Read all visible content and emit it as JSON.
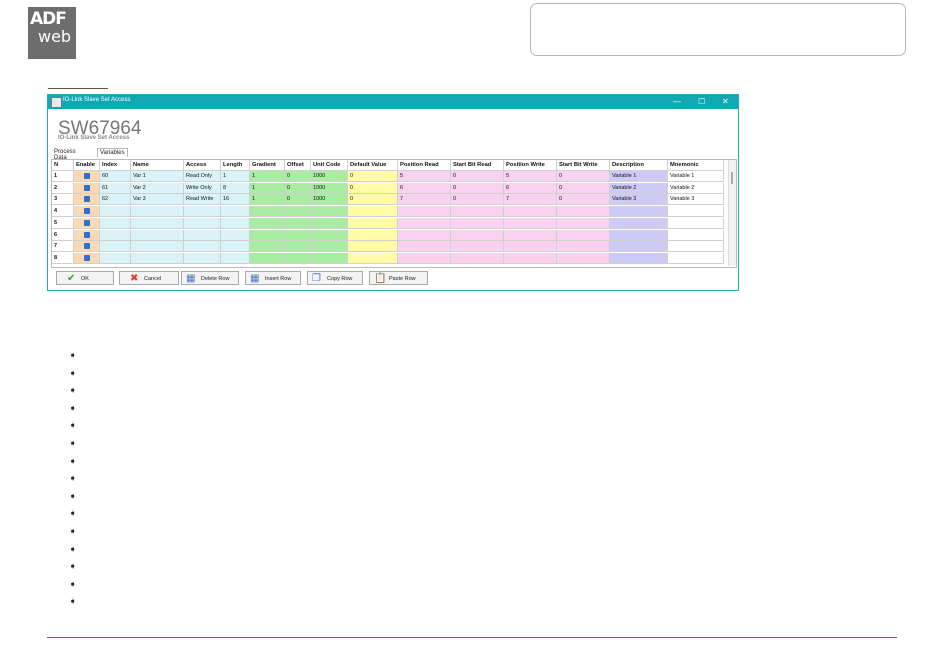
{
  "logo": {
    "line1": "ADF",
    "line2": "web"
  },
  "window": {
    "title": "IO-Link Slave Set Access",
    "controls": {
      "minimize": "—",
      "maximize": "☐",
      "close": "✕"
    },
    "big_title": "SW67964",
    "subtitle": "IO-Link Slave Set Access",
    "tabs": [
      "Process Data",
      "Variables"
    ],
    "active_tab": "Variables"
  },
  "table": {
    "columns": [
      "N",
      "Enable",
      "Index",
      "Name",
      "Access",
      "Length",
      "Gradient",
      "Offset",
      "Unit Code",
      "Default Value",
      "Position Read",
      "Start Bit Read",
      "Position Write",
      "Start Bit Write",
      "Description",
      "Mnemonic"
    ],
    "rows": [
      [
        "1",
        "",
        "60",
        "Var 1",
        "Read Only",
        "1",
        "1",
        "0",
        "1000",
        "0",
        "5",
        "0",
        "5",
        "0",
        "Variable 1",
        "Variable 1"
      ],
      [
        "2",
        "",
        "61",
        "Var 2",
        "Write Only",
        "8",
        "1",
        "0",
        "1000",
        "0",
        "6",
        "0",
        "6",
        "0",
        "Variable 2",
        "Variable 2"
      ],
      [
        "3",
        "",
        "62",
        "Var 3",
        "Read Write",
        "16",
        "1",
        "0",
        "1000",
        "0",
        "7",
        "0",
        "7",
        "0",
        "Variable 3",
        "Variable 3"
      ],
      [
        "4",
        "",
        "",
        "",
        "",
        "",
        "",
        "",
        "",
        "",
        "",
        "",
        "",
        "",
        "",
        ""
      ],
      [
        "5",
        "",
        "",
        "",
        "",
        "",
        "",
        "",
        "",
        "",
        "",
        "",
        "",
        "",
        "",
        ""
      ],
      [
        "6",
        "",
        "",
        "",
        "",
        "",
        "",
        "",
        "",
        "",
        "",
        "",
        "",
        "",
        "",
        ""
      ],
      [
        "7",
        "",
        "",
        "",
        "",
        "",
        "",
        "",
        "",
        "",
        "",
        "",
        "",
        "",
        "",
        ""
      ],
      [
        "8",
        "",
        "",
        "",
        "",
        "",
        "",
        "",
        "",
        "",
        "",
        "",
        "",
        "",
        "",
        ""
      ]
    ],
    "column_colors": {
      "N": "#ffffff",
      "Enable": "#fbd9b4",
      "Index": "#d9f3f8",
      "Name": "#d9f3f8",
      "Access": "#d9f3f8",
      "Length": "#d9f3f8",
      "Gradient": "#a8eda2",
      "Offset": "#a8eda2",
      "Unit Code": "#a8eda2",
      "Default Value": "#fffba6",
      "Position Read": "#f9d2f0",
      "Start Bit Read": "#f9d2f0",
      "Position Write": "#f9d2f0",
      "Start Bit Write": "#f9d2f0",
      "Description": "#cfc9f5",
      "Mnemonic": "#ffffff"
    }
  },
  "buttons": [
    {
      "label": "OK",
      "icon": "check-icon",
      "color": "#2da32d"
    },
    {
      "label": "Cancel",
      "icon": "x-icon",
      "color": "#e23b25"
    },
    {
      "label": "Delete Row",
      "icon": "delete-row-icon",
      "color": "#4a78b8"
    },
    {
      "label": "Insert Row",
      "icon": "insert-row-icon",
      "color": "#4a78b8"
    },
    {
      "label": "Copy Row",
      "icon": "copy-row-icon",
      "color": "#4a78b8"
    },
    {
      "label": "Paste Row",
      "icon": "paste-row-icon",
      "color": "#d99a2b"
    }
  ],
  "bullet_glyph": "➧",
  "bullet_count": 15
}
